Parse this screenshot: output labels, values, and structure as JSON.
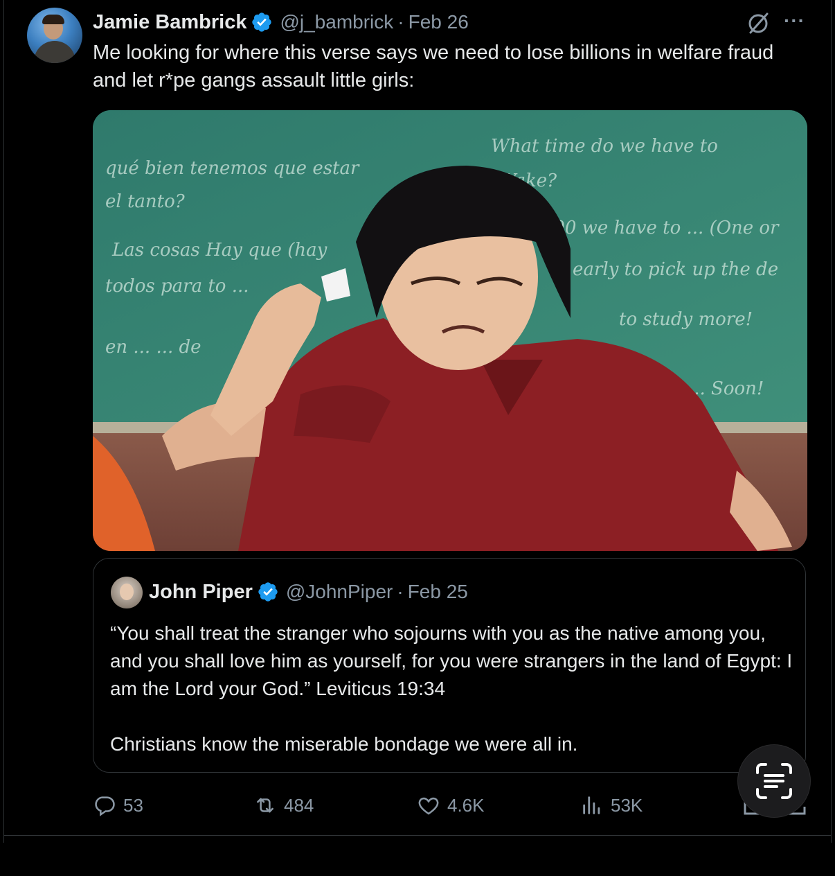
{
  "tweet": {
    "author_name": "Jamie Bambrick",
    "handle": "@j_bambrick",
    "separator": "·",
    "date": "Feb 26",
    "text": "Me looking for where this verse says we need to lose billions in welfare fraud and let r*pe gangs assault little girls:"
  },
  "media": {
    "chalk_lines": [
      "qué bien tenemos que estar",
      "el tanto?",
      "Las cosas Hay que (hay",
      "todos para to ...",
      "en ... ... de",
      "What time do we have to",
      "Wake?",
      "9:00 we have to ... (One or",
      "... early to pick up the de",
      "to study more!",
      "... Soon!"
    ]
  },
  "quote": {
    "author_name": "John Piper",
    "handle": "@JohnPiper",
    "separator": "·",
    "date": "Feb 25",
    "paragraph_1": "“You shall treat the stranger who sojourns with you as the native among you, and you shall love him as yourself, for you were strangers in the land of Egypt: I am the Lord your God.” Leviticus 19:34",
    "paragraph_2": "Christians know the miserable bondage we were all in."
  },
  "actions": {
    "replies": "53",
    "reposts": "484",
    "likes": "4.6K",
    "views": "53K"
  },
  "icons": {
    "verified": "verified-badge-icon",
    "grok": "grok-icon",
    "more": "more-icon",
    "reply": "reply-icon",
    "repost": "repost-icon",
    "like": "like-icon",
    "views": "views-icon",
    "scan": "live-text-icon"
  },
  "colors": {
    "background": "#000000",
    "text": "#e7e9ea",
    "secondary_text": "#8b98a5",
    "verified_blue": "#1d9bf0",
    "border": "#2f3336"
  }
}
